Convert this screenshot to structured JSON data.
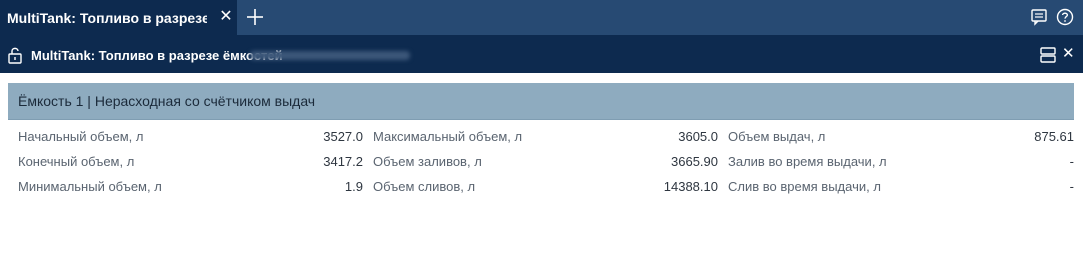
{
  "tabs": [
    {
      "title": "MultiTank: Топливо в разрезе ёмко..."
    }
  ],
  "tab_close_symbol": "✕",
  "subheader": {
    "title": "MultiTank: Топливо в разрезе ёмкостей",
    "close_symbol": "✕"
  },
  "icons": {
    "new_tab": "plus-icon",
    "chat": "chat-icon",
    "help": "help-icon",
    "lock": "unlock-icon",
    "layout": "layout-icon",
    "close": "close-icon"
  },
  "colors": {
    "tabbar": "#274a73",
    "active_tab": "#0d2a4f",
    "section_header": "#8eabbf"
  },
  "section": {
    "title": "Ёмкость 1 | Нерасходная со счётчиком выдач"
  },
  "columns": [
    {
      "rows": [
        {
          "label": "Начальный объем, л",
          "value": "3527.0"
        },
        {
          "label": "Конечный объем, л",
          "value": "3417.2"
        },
        {
          "label": "Минимальный объем, л",
          "value": "1.9"
        }
      ]
    },
    {
      "rows": [
        {
          "label": "Максимальный объем, л",
          "value": "3605.0"
        },
        {
          "label": "Объем заливов, л",
          "value": "3665.90"
        },
        {
          "label": "Объем сливов, л",
          "value": "14388.10"
        }
      ]
    },
    {
      "rows": [
        {
          "label": "Объем выдач, л",
          "value": "875.61"
        },
        {
          "label": "Залив во время выдачи, л",
          "value": "-"
        },
        {
          "label": "Слив во время выдачи, л",
          "value": "-"
        }
      ]
    }
  ]
}
